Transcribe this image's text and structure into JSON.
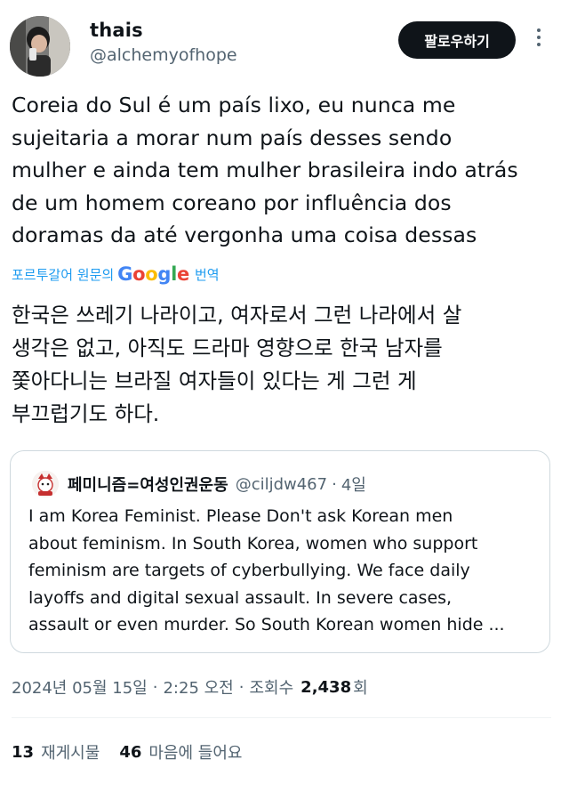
{
  "author": {
    "display_name": "thais",
    "handle": "@alchemyofhope"
  },
  "header": {
    "follow_label": "팔로우하기",
    "more_icon": "more-vertical-icon"
  },
  "tweet": {
    "lines": [
      "Coreia do Sul é um país lixo, eu nunca me",
      "sujeitaria a morar num país desses sendo",
      "mulher e ainda tem mulher brasileira indo atrás",
      "de um homem coreano por influência dos",
      "doramas da até vergonha uma coisa dessas"
    ]
  },
  "translation": {
    "label_prefix": "포르투갈어 원문의",
    "google_word": "Google",
    "label_suffix": "번역",
    "lines": [
      "한국은 쓰레기 나라이고, 여자로서 그런 나라에서 살",
      "생각은 없고, 아직도 드라마 영향으로 한국 남자를",
      "쫓아다니는 브라질 여자들이 있다는 게 그런 게",
      "부끄럽기도 하다."
    ]
  },
  "quote": {
    "display_name": "페미니즘=여성인권운동",
    "handle": "@ciljdw467",
    "separator": "·",
    "time": "4일",
    "lines": [
      "I am Korea Feminist. Please Don't ask Korean men",
      "about feminism. In South Korea, women who support",
      "feminism are targets of cyberbullying. We face daily",
      "layoffs and digital sexual assault. In severe cases,",
      "assault or even murder. So South Korean women hide ..."
    ]
  },
  "meta": {
    "date": "2024년 05월 15일",
    "separator": "·",
    "time": "2:25 오전",
    "views_label_prefix": "조회수",
    "views_count": "2,438",
    "views_label_suffix": "회"
  },
  "stats": {
    "reposts_count": "13",
    "reposts_label": "재게시물",
    "likes_count": "46",
    "likes_label": "마음에 들어요"
  },
  "colors": {
    "accent_blue": "#1d9bf0",
    "text_primary": "#0f1419",
    "text_secondary": "#536471",
    "border": "#cfd9de"
  }
}
